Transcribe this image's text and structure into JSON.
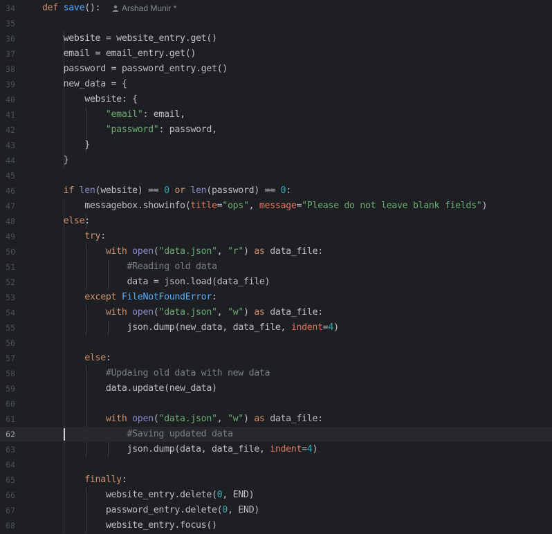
{
  "editor": {
    "author_hint": "Arshad Munir *",
    "current_line": "62",
    "lines": [
      {
        "num": "34",
        "tokens": [
          {
            "t": "def ",
            "c": "kw"
          },
          {
            "t": "save",
            "c": "fn"
          },
          {
            "t": "():",
            "c": "txt"
          }
        ]
      },
      {
        "num": "35",
        "tokens": []
      },
      {
        "num": "36",
        "tokens": [
          {
            "t": "    website = website_entry.get()",
            "c": "txt"
          }
        ]
      },
      {
        "num": "37",
        "tokens": [
          {
            "t": "    email = email_entry.get()",
            "c": "txt"
          }
        ]
      },
      {
        "num": "38",
        "tokens": [
          {
            "t": "    password = password_entry.get()",
            "c": "txt"
          }
        ]
      },
      {
        "num": "39",
        "tokens": [
          {
            "t": "    new_data = {",
            "c": "txt"
          }
        ]
      },
      {
        "num": "40",
        "tokens": [
          {
            "t": "        website: {",
            "c": "txt"
          }
        ]
      },
      {
        "num": "41",
        "tokens": [
          {
            "t": "            ",
            "c": "txt"
          },
          {
            "t": "\"email\"",
            "c": "str"
          },
          {
            "t": ": email,",
            "c": "txt"
          }
        ]
      },
      {
        "num": "42",
        "tokens": [
          {
            "t": "            ",
            "c": "txt"
          },
          {
            "t": "\"password\"",
            "c": "str"
          },
          {
            "t": ": password,",
            "c": "txt"
          }
        ]
      },
      {
        "num": "43",
        "tokens": [
          {
            "t": "        }",
            "c": "txt"
          }
        ]
      },
      {
        "num": "44",
        "tokens": [
          {
            "t": "    }",
            "c": "txt"
          }
        ]
      },
      {
        "num": "45",
        "tokens": []
      },
      {
        "num": "46",
        "tokens": [
          {
            "t": "    ",
            "c": "txt"
          },
          {
            "t": "if ",
            "c": "kw"
          },
          {
            "t": "len",
            "c": "bi"
          },
          {
            "t": "(website) == ",
            "c": "txt"
          },
          {
            "t": "0",
            "c": "num"
          },
          {
            "t": " ",
            "c": "txt"
          },
          {
            "t": "or ",
            "c": "kw"
          },
          {
            "t": "len",
            "c": "bi"
          },
          {
            "t": "(password) == ",
            "c": "txt"
          },
          {
            "t": "0",
            "c": "num"
          },
          {
            "t": ":",
            "c": "txt"
          }
        ]
      },
      {
        "num": "47",
        "tokens": [
          {
            "t": "        messagebox.showinfo(",
            "c": "txt"
          },
          {
            "t": "title",
            "c": "named"
          },
          {
            "t": "=",
            "c": "txt"
          },
          {
            "t": "\"ops\"",
            "c": "str"
          },
          {
            "t": ", ",
            "c": "txt"
          },
          {
            "t": "message",
            "c": "named"
          },
          {
            "t": "=",
            "c": "txt"
          },
          {
            "t": "\"Please do not leave blank fields\"",
            "c": "str"
          },
          {
            "t": ")",
            "c": "txt"
          }
        ]
      },
      {
        "num": "48",
        "tokens": [
          {
            "t": "    ",
            "c": "txt"
          },
          {
            "t": "else",
            "c": "kw"
          },
          {
            "t": ":",
            "c": "txt"
          }
        ]
      },
      {
        "num": "49",
        "tokens": [
          {
            "t": "        ",
            "c": "txt"
          },
          {
            "t": "try",
            "c": "kw"
          },
          {
            "t": ":",
            "c": "txt"
          }
        ]
      },
      {
        "num": "50",
        "tokens": [
          {
            "t": "            ",
            "c": "txt"
          },
          {
            "t": "with ",
            "c": "kw"
          },
          {
            "t": "open",
            "c": "bi"
          },
          {
            "t": "(",
            "c": "txt"
          },
          {
            "t": "\"data.json\"",
            "c": "str"
          },
          {
            "t": ", ",
            "c": "txt"
          },
          {
            "t": "\"r\"",
            "c": "str"
          },
          {
            "t": ") ",
            "c": "txt"
          },
          {
            "t": "as ",
            "c": "kw"
          },
          {
            "t": "data_file:",
            "c": "txt"
          }
        ]
      },
      {
        "num": "51",
        "tokens": [
          {
            "t": "                ",
            "c": "txt"
          },
          {
            "t": "#Reading old data",
            "c": "cmt"
          }
        ]
      },
      {
        "num": "52",
        "tokens": [
          {
            "t": "                data = json.load(data_file)",
            "c": "txt"
          }
        ]
      },
      {
        "num": "53",
        "tokens": [
          {
            "t": "        ",
            "c": "txt"
          },
          {
            "t": "except ",
            "c": "kw"
          },
          {
            "t": "FileNotFoundError",
            "c": "cls"
          },
          {
            "t": ":",
            "c": "txt"
          }
        ]
      },
      {
        "num": "54",
        "tokens": [
          {
            "t": "            ",
            "c": "txt"
          },
          {
            "t": "with ",
            "c": "kw"
          },
          {
            "t": "open",
            "c": "bi"
          },
          {
            "t": "(",
            "c": "txt"
          },
          {
            "t": "\"data.json\"",
            "c": "str"
          },
          {
            "t": ", ",
            "c": "txt"
          },
          {
            "t": "\"w\"",
            "c": "str"
          },
          {
            "t": ") ",
            "c": "txt"
          },
          {
            "t": "as ",
            "c": "kw"
          },
          {
            "t": "data_file:",
            "c": "txt"
          }
        ]
      },
      {
        "num": "55",
        "tokens": [
          {
            "t": "                json.dump(new_data, data_file, ",
            "c": "txt"
          },
          {
            "t": "indent",
            "c": "named"
          },
          {
            "t": "=",
            "c": "txt"
          },
          {
            "t": "4",
            "c": "num"
          },
          {
            "t": ")",
            "c": "txt"
          }
        ]
      },
      {
        "num": "56",
        "tokens": []
      },
      {
        "num": "57",
        "tokens": [
          {
            "t": "        ",
            "c": "txt"
          },
          {
            "t": "else",
            "c": "kw"
          },
          {
            "t": ":",
            "c": "txt"
          }
        ]
      },
      {
        "num": "58",
        "tokens": [
          {
            "t": "            ",
            "c": "txt"
          },
          {
            "t": "#Updaing old data with new data",
            "c": "cmt"
          }
        ]
      },
      {
        "num": "59",
        "tokens": [
          {
            "t": "            data.update(new_data)",
            "c": "txt"
          }
        ]
      },
      {
        "num": "60",
        "tokens": []
      },
      {
        "num": "61",
        "tokens": [
          {
            "t": "            ",
            "c": "txt"
          },
          {
            "t": "with ",
            "c": "kw"
          },
          {
            "t": "open",
            "c": "bi"
          },
          {
            "t": "(",
            "c": "txt"
          },
          {
            "t": "\"data.json\"",
            "c": "str"
          },
          {
            "t": ", ",
            "c": "txt"
          },
          {
            "t": "\"w\"",
            "c": "str"
          },
          {
            "t": ") ",
            "c": "txt"
          },
          {
            "t": "as ",
            "c": "kw"
          },
          {
            "t": "data_file:",
            "c": "txt"
          }
        ]
      },
      {
        "num": "62",
        "tokens": [
          {
            "t": "                ",
            "c": "txt"
          },
          {
            "t": "#Saving updated data",
            "c": "cmt"
          }
        ]
      },
      {
        "num": "63",
        "tokens": [
          {
            "t": "                json.dump(data, data_file, ",
            "c": "txt"
          },
          {
            "t": "indent",
            "c": "named"
          },
          {
            "t": "=",
            "c": "txt"
          },
          {
            "t": "4",
            "c": "num"
          },
          {
            "t": ")",
            "c": "txt"
          }
        ]
      },
      {
        "num": "64",
        "tokens": []
      },
      {
        "num": "65",
        "tokens": [
          {
            "t": "        ",
            "c": "txt"
          },
          {
            "t": "finally",
            "c": "kw"
          },
          {
            "t": ":",
            "c": "txt"
          }
        ]
      },
      {
        "num": "66",
        "tokens": [
          {
            "t": "            website_entry.delete(",
            "c": "txt"
          },
          {
            "t": "0",
            "c": "num"
          },
          {
            "t": ", END)",
            "c": "txt"
          }
        ]
      },
      {
        "num": "67",
        "tokens": [
          {
            "t": "            password_entry.delete(",
            "c": "txt"
          },
          {
            "t": "0",
            "c": "num"
          },
          {
            "t": ", END)",
            "c": "txt"
          }
        ]
      },
      {
        "num": "68",
        "tokens": [
          {
            "t": "            website_entry.focus()",
            "c": "txt"
          }
        ]
      }
    ]
  },
  "colors": {
    "background": "#1e1f22",
    "keyword": "#cf8e6d",
    "function": "#56a8f5",
    "string": "#6aab73",
    "number": "#2aacb8",
    "comment": "#7a7e85",
    "named_arg": "#e0735e",
    "builtin": "#8888c6",
    "text": "#bcbec4"
  }
}
